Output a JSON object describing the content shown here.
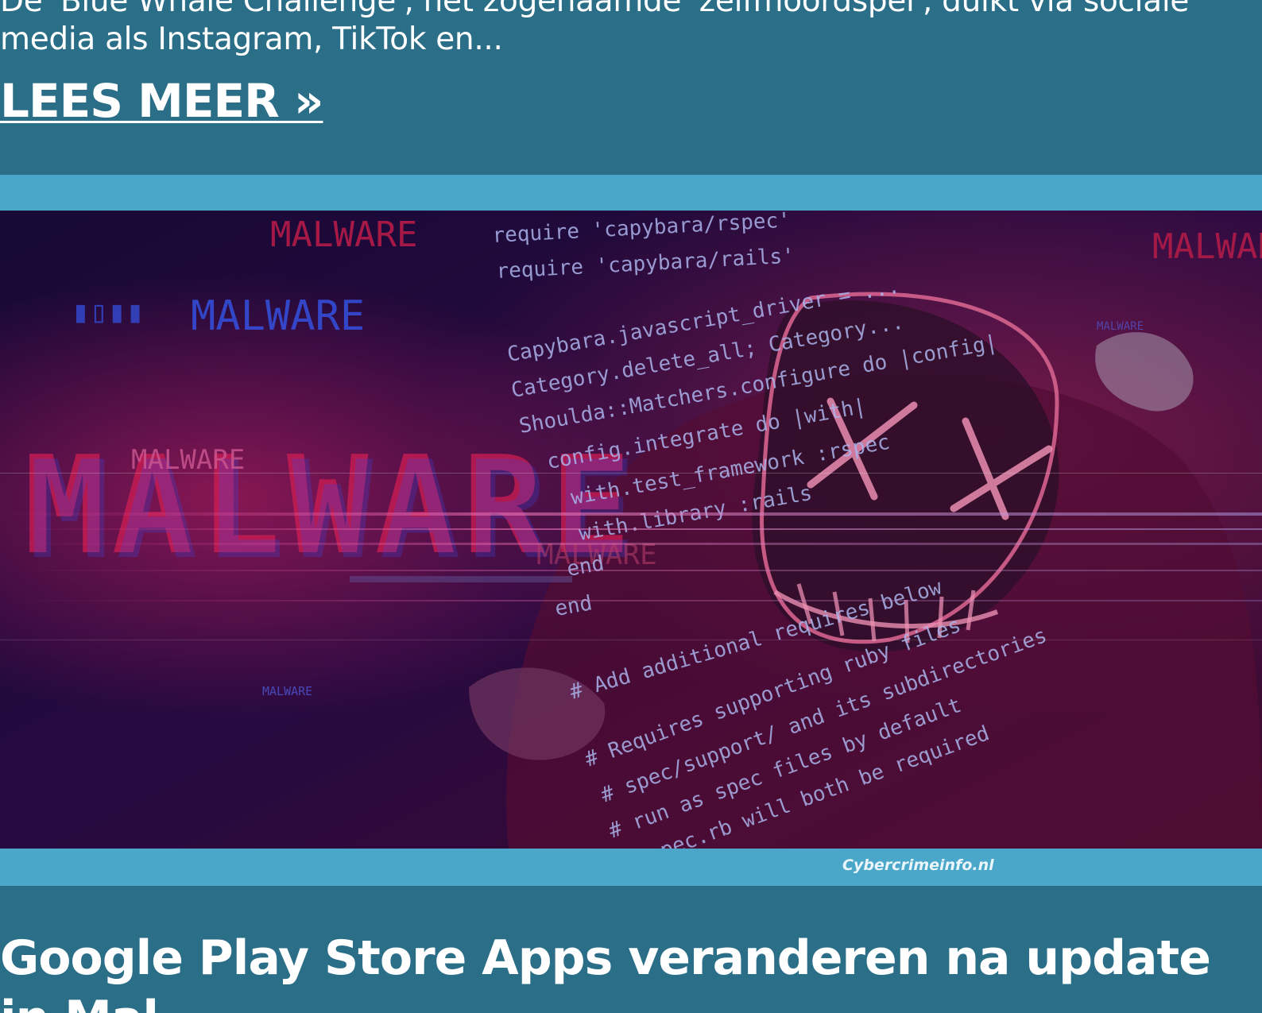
{
  "previous_post": {
    "excerpt": "De 'Blue Whale Challenge', het zogenaamde 'zelfmoordspel', duikt via sociale media als Instagram, TikTok en...",
    "read_more": "LEES MEER »"
  },
  "hero_image": {
    "big_text": "MALWARE",
    "small_texts": [
      "MALWARE",
      "MALWARE",
      "MALWARE",
      "MALWARE",
      "MALWARE",
      "MALWARE"
    ],
    "code_lines": [
      "require 'capybara/rspec'",
      "require 'capybara/rails'",
      "Capybara.javascript_driver = ...",
      "Category.delete_all; Category...",
      "Shoulda::Matchers.configure do |config|",
      "config.integrate do |with|",
      "with.test_framework :rspec",
      "with.library :rails",
      "end",
      "end",
      "# Add additional requires below",
      "# Requires supporting ruby files",
      "# spec/support/ and its subdirectories",
      "# run as spec files by default",
      "spec.rb will both be required"
    ],
    "watermark": "Cybercrimeinfo.nl"
  },
  "next_post": {
    "title": "Google Play Store Apps veranderen na update in Mal..."
  },
  "colors": {
    "background": "#2b6e87",
    "frame": "#4aa7c9",
    "text": "#ffffff"
  }
}
